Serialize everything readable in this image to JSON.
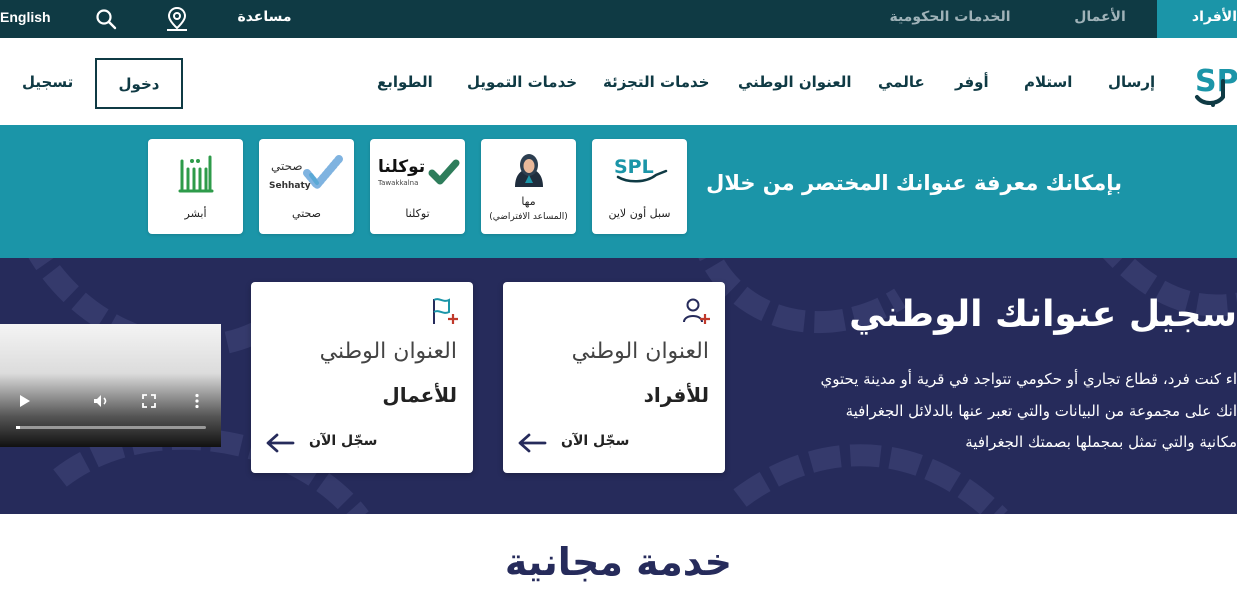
{
  "topbar": {
    "individuals": "الأفراد",
    "business": "الأعمال",
    "government": "الخدمات الحكومية",
    "help": "مساعدة",
    "language": "English"
  },
  "nav": {
    "items": [
      "إرسال",
      "استلام",
      "أوفر",
      "عالمي",
      "العنوان الوطني",
      "خدمات التجزئة",
      "خدمات التمويل",
      "الطوابع"
    ],
    "login": "دخول",
    "register": "تسجيل"
  },
  "banner": {
    "text": "بإمكانك معرفة عنوانك المختصر من خلال",
    "services": [
      {
        "label": "سبل أون لاين"
      },
      {
        "label": "مها",
        "sub": "(المساعد الافتراضي)"
      },
      {
        "label": "توكلنا",
        "logo_text": "توكلنا",
        "logo_sub": "Tawakkalna"
      },
      {
        "label": "صحتي",
        "logo_text": "صحتي",
        "logo_sub": "Sehhaty"
      },
      {
        "label": "أبشر",
        "logo_text": "أبشر"
      }
    ]
  },
  "hero": {
    "title": "سجيل عنوانك الوطني",
    "lines": [
      "اء كنت فرد، قطاع تجاري أو حكومي تتواجد في قرية أو مدينة يحتوي",
      "انك على مجموعة من البيانات والتي تعبر عنها بالدلائل الجغرافية",
      "مكانية والتي تمثل بمجملها بصمتك الجغرافية"
    ],
    "cards": [
      {
        "title": "العنوان الوطني",
        "sub": "للأفراد",
        "cta": "سجّل الآن"
      },
      {
        "title": "العنوان الوطني",
        "sub": "للأعمال",
        "cta": "سجّل الآن"
      }
    ]
  },
  "section": {
    "title": "خدمة مجانية"
  },
  "colors": {
    "dark_teal": "#0f3a44",
    "teal": "#1b95a8",
    "navy": "#262b5b",
    "accent_red": "#c0392b"
  }
}
